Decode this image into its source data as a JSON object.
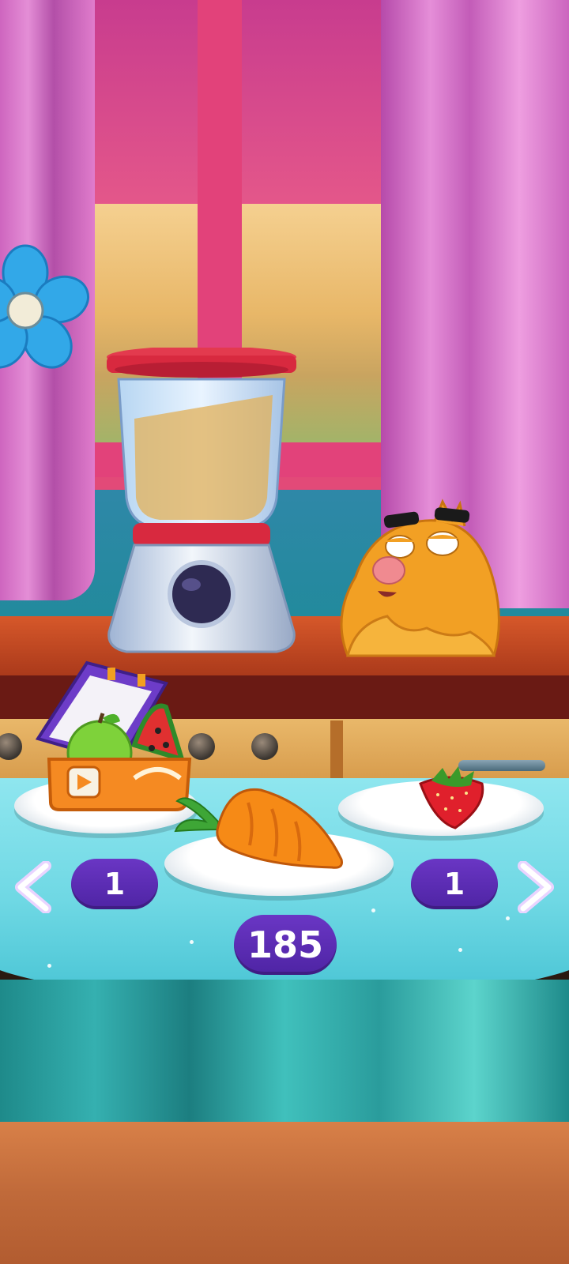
{
  "screen": "blender-food-selection",
  "carousel": {
    "left_item": {
      "name": "lunch-box",
      "count": "1"
    },
    "center_item": {
      "name": "carrot"
    },
    "right_item": {
      "name": "strawberry",
      "count": "1"
    }
  },
  "center_value": "185",
  "icons": [
    "flower-icon",
    "chevron-left-icon",
    "chevron-right-icon",
    "video-ad-icon"
  ],
  "colors": {
    "pill_bg": "#4e24a4",
    "curtain": "#e48ed6",
    "window_frame": "#e2427a",
    "table": "#6fd8e4",
    "counter": "#d6582a",
    "arrow": "#f4e6ff"
  }
}
